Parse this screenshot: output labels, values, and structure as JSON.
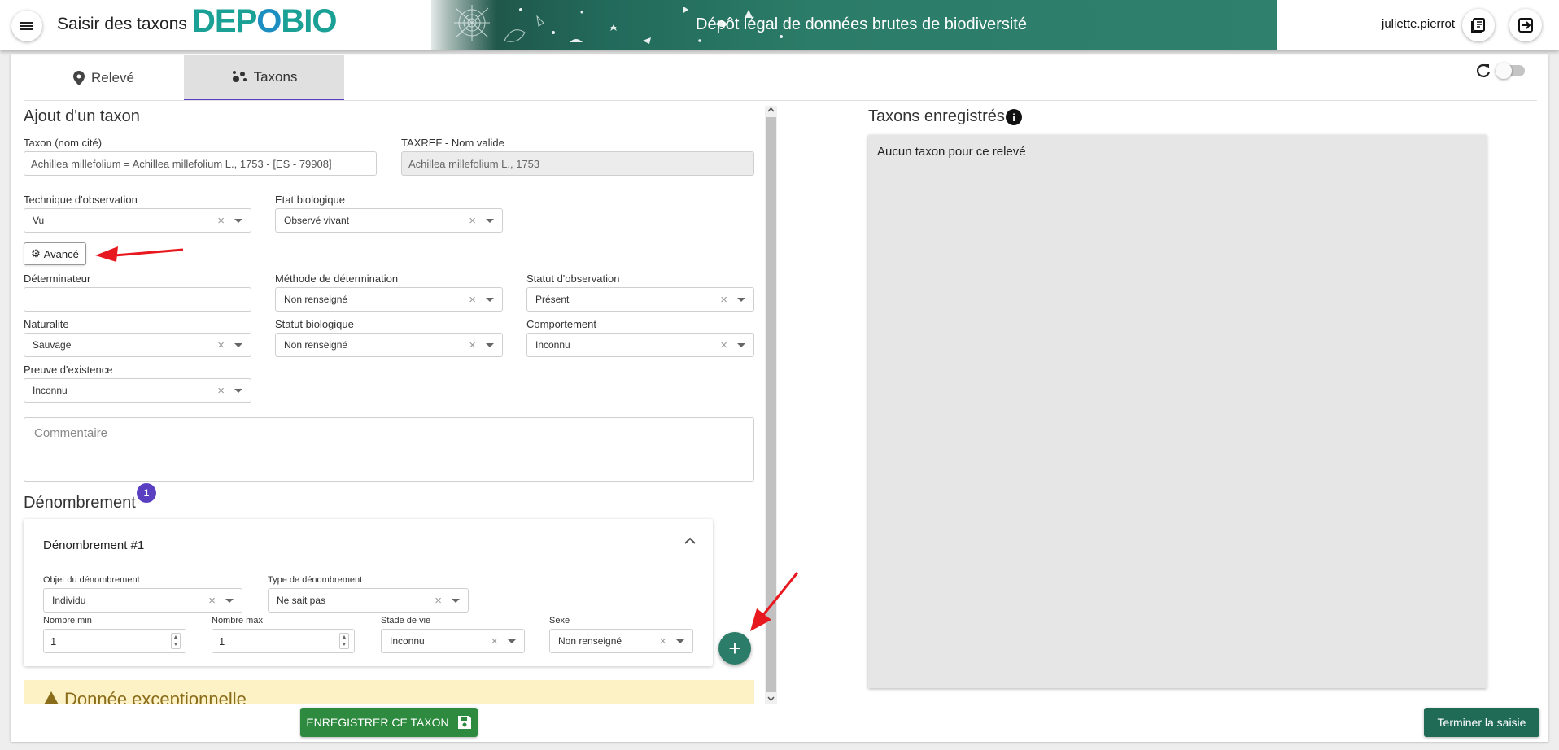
{
  "header": {
    "app_title": "Saisir des taxons",
    "logo_text": "DEPOBIO",
    "banner_title": "Dépôt légal de données brutes de biodiversité",
    "username": "juliette.pierrot",
    "icons": [
      "menu-icon",
      "book-icon",
      "logout-icon"
    ]
  },
  "tabs": [
    {
      "label": "Relevé",
      "icon": "map-marker-icon",
      "active": false
    },
    {
      "label": "Taxons",
      "icon": "paw-icon",
      "active": true
    }
  ],
  "form": {
    "title": "Ajout d'un taxon",
    "taxon": {
      "label": "Taxon (nom cité)",
      "value": "Achillea millefolium =   Achillea millefolium L., 1753 - [ES - 79908]"
    },
    "taxref": {
      "label": "TAXREF - Nom valide",
      "value": "Achillea millefolium L., 1753"
    },
    "technique": {
      "label": "Technique d'observation",
      "value": "Vu"
    },
    "etat_bio": {
      "label": "Etat biologique",
      "value": "Observé vivant"
    },
    "advanced_button": "Avancé",
    "determinateur": {
      "label": "Déterminateur",
      "value": ""
    },
    "methode_det": {
      "label": "Méthode de détermination",
      "value": "Non renseigné"
    },
    "statut_obs": {
      "label": "Statut d'observation",
      "value": "Présent"
    },
    "naturalite": {
      "label": "Naturalite",
      "value": "Sauvage"
    },
    "statut_bio": {
      "label": "Statut biologique",
      "value": "Non renseigné"
    },
    "comportement": {
      "label": "Comportement",
      "value": "Inconnu"
    },
    "preuve": {
      "label": "Preuve d'existence",
      "value": "Inconnu"
    },
    "commentaire_placeholder": "Commentaire"
  },
  "denombrement": {
    "title": "Dénombrement",
    "count_badge": "1",
    "card_title": "Dénombrement #1",
    "objet": {
      "label": "Objet du dénombrement",
      "value": "Individu"
    },
    "type": {
      "label": "Type de dénombrement",
      "value": "Ne sait pas"
    },
    "nombre_min": {
      "label": "Nombre min",
      "value": "1"
    },
    "nombre_max": {
      "label": "Nombre max",
      "value": "1"
    },
    "stade": {
      "label": "Stade de vie",
      "value": "Inconnu"
    },
    "sexe": {
      "label": "Sexe",
      "value": "Non renseigné"
    }
  },
  "warning": {
    "text": "Donnée exceptionnelle"
  },
  "buttons": {
    "save": "ENREGISTRER CE TAXON",
    "finish": "Terminer la saisie"
  },
  "right_panel": {
    "title": "Taxons enregistrés",
    "empty_text": "Aucun taxon pour ce relevé"
  },
  "colors": {
    "accent_green": "#2b7c68",
    "save_green": "#2d8a3e",
    "tab_indicator": "#5a3fc0",
    "logo_teal": "#1aa094",
    "annotation_arrow": "#e8181f"
  }
}
